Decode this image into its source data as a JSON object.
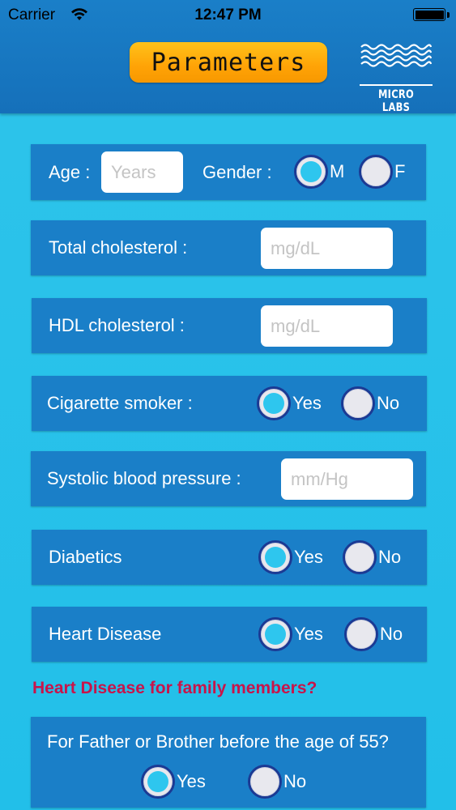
{
  "status_bar": {
    "carrier": "Carrier",
    "time": "12:47 PM"
  },
  "header": {
    "title": "Parameters",
    "logo_text": "MICRO LABS"
  },
  "form": {
    "age_label": "Age :",
    "age_placeholder": "Years",
    "gender_label": "Gender :",
    "gender_male": "M",
    "gender_female": "F",
    "total_chol_label": "Total cholesterol :",
    "total_chol_placeholder": "mg/dL",
    "hdl_label": "HDL cholesterol :",
    "hdl_placeholder": "mg/dL",
    "smoker_label": "Cigarette smoker :",
    "sbp_label": "Systolic blood pressure :",
    "sbp_placeholder": "mm/Hg",
    "diabetics_label": "Diabetics",
    "heart_label": "Heart Disease",
    "family_heading": "Heart Disease for family members?",
    "father_label": "For Father or Brother before the age of 55?",
    "yes": "Yes",
    "no": "No"
  },
  "selected": {
    "gender": "M",
    "smoker": "Yes",
    "diabetics": "Yes",
    "heart_disease": "Yes",
    "father_brother": "Yes"
  },
  "colors": {
    "header": "#1a7fc8",
    "background": "#22bfe9",
    "title_pill": "#ffa306",
    "accent_dot": "#2ec6ee",
    "heading": "#c8144a"
  }
}
